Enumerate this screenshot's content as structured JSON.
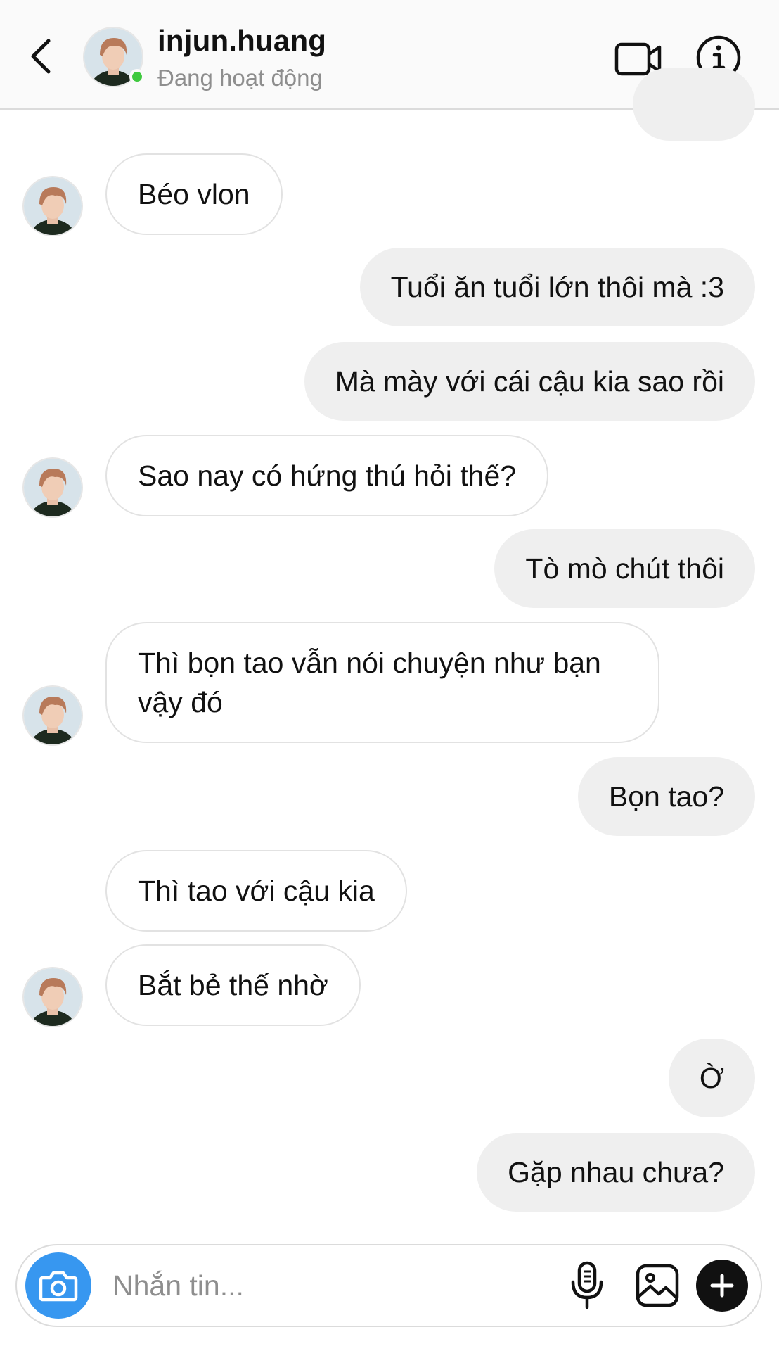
{
  "header": {
    "username": "injun.huang",
    "status": "Đang hoạt động",
    "icons": {
      "back": "chevron-left-icon",
      "video": "video-camera-icon",
      "info": "info-icon"
    },
    "online_color": "#3fc93f"
  },
  "messages": [
    {
      "direction": "incoming",
      "text": "Béo vlon",
      "show_avatar": true
    },
    {
      "direction": "outgoing",
      "text": "Tuổi ăn tuổi lớn thôi mà :3"
    },
    {
      "direction": "outgoing",
      "text": "Mà mày với cái cậu kia sao rồi"
    },
    {
      "direction": "incoming",
      "text": "Sao nay có hứng thú hỏi thế?",
      "show_avatar": true
    },
    {
      "direction": "outgoing",
      "text": "Tò mò chút thôi"
    },
    {
      "direction": "incoming",
      "text": "Thì bọn tao vẫn nói chuyện như bạn vậy đó",
      "show_avatar": true
    },
    {
      "direction": "outgoing",
      "text": "Bọn tao?"
    },
    {
      "direction": "incoming",
      "text": "Thì tao với cậu kia",
      "show_avatar": false
    },
    {
      "direction": "incoming",
      "text": "Bắt bẻ thế nhờ",
      "show_avatar": true
    },
    {
      "direction": "outgoing",
      "text": "Ờ"
    },
    {
      "direction": "outgoing",
      "text": "Gặp nhau chưa?"
    }
  ],
  "composer": {
    "placeholder": "Nhắn tin...",
    "icons": {
      "camera": "camera-icon",
      "mic": "microphone-icon",
      "gallery": "image-gallery-icon",
      "plus": "plus-icon"
    },
    "camera_color": "#3797f0"
  },
  "colors": {
    "outgoing_bubble": "#efefef",
    "incoming_border": "#e2e2e2",
    "secondary_text": "#8e8e8e"
  }
}
